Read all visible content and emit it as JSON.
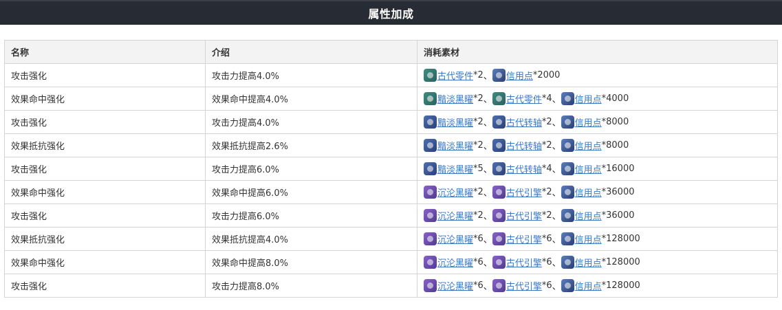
{
  "header": {
    "title": "属性加成"
  },
  "table": {
    "columns": [
      "名称",
      "介绍",
      "消耗素材"
    ],
    "rows": [
      {
        "name": "攻击强化",
        "desc": "攻击力提高4.0%",
        "materials": [
          {
            "icon": "gear-part-icon",
            "color": "green",
            "name": "古代零件",
            "count": "*2",
            "sep": "、"
          },
          {
            "icon": "credit-icon",
            "color": "credit",
            "name": "信用点",
            "count": "*2000",
            "sep": ""
          }
        ]
      },
      {
        "name": "效果命中强化",
        "desc": "效果命中提高4.0%",
        "materials": [
          {
            "icon": "obsidian-icon",
            "color": "green",
            "name": "黯淡黑曜",
            "count": "*2",
            "sep": "、"
          },
          {
            "icon": "gear-part-icon",
            "color": "green",
            "name": "古代零件",
            "count": "*4",
            "sep": "、"
          },
          {
            "icon": "credit-icon",
            "color": "credit",
            "name": "信用点",
            "count": "*4000",
            "sep": ""
          }
        ]
      },
      {
        "name": "攻击强化",
        "desc": "攻击力提高4.0%",
        "materials": [
          {
            "icon": "obsidian-icon",
            "color": "blue",
            "name": "黯淡黑曜",
            "count": "*2",
            "sep": "、"
          },
          {
            "icon": "shaft-icon",
            "color": "blue",
            "name": "古代转轴",
            "count": "*2",
            "sep": "、"
          },
          {
            "icon": "credit-icon",
            "color": "credit",
            "name": "信用点",
            "count": "*8000",
            "sep": ""
          }
        ]
      },
      {
        "name": "效果抵抗强化",
        "desc": "效果抵抗提高2.6%",
        "materials": [
          {
            "icon": "obsidian-icon",
            "color": "blue",
            "name": "黯淡黑曜",
            "count": "*2",
            "sep": "、"
          },
          {
            "icon": "shaft-icon",
            "color": "blue",
            "name": "古代转轴",
            "count": "*2",
            "sep": "、"
          },
          {
            "icon": "credit-icon",
            "color": "credit",
            "name": "信用点",
            "count": "*8000",
            "sep": ""
          }
        ]
      },
      {
        "name": "攻击强化",
        "desc": "攻击力提高6.0%",
        "materials": [
          {
            "icon": "obsidian-icon",
            "color": "blue",
            "name": "黯淡黑曜",
            "count": "*5",
            "sep": "、"
          },
          {
            "icon": "shaft-icon",
            "color": "blue",
            "name": "古代转轴",
            "count": "*4",
            "sep": "、"
          },
          {
            "icon": "credit-icon",
            "color": "credit",
            "name": "信用点",
            "count": "*16000",
            "sep": ""
          }
        ]
      },
      {
        "name": "效果命中强化",
        "desc": "效果命中提高6.0%",
        "materials": [
          {
            "icon": "sinking-obsidian-icon",
            "color": "purple",
            "name": "沉沦黑曜",
            "count": "*2",
            "sep": "、"
          },
          {
            "icon": "engine-icon",
            "color": "purple",
            "name": "古代引擎",
            "count": "*2",
            "sep": "、"
          },
          {
            "icon": "credit-icon",
            "color": "credit",
            "name": "信用点",
            "count": "*36000",
            "sep": ""
          }
        ]
      },
      {
        "name": "攻击强化",
        "desc": "攻击力提高6.0%",
        "materials": [
          {
            "icon": "sinking-obsidian-icon",
            "color": "purple",
            "name": "沉沦黑曜",
            "count": "*2",
            "sep": "、"
          },
          {
            "icon": "engine-icon",
            "color": "purple",
            "name": "古代引擎",
            "count": "*2",
            "sep": "、"
          },
          {
            "icon": "credit-icon",
            "color": "credit",
            "name": "信用点",
            "count": "*36000",
            "sep": ""
          }
        ]
      },
      {
        "name": "效果抵抗强化",
        "desc": "效果抵抗提高4.0%",
        "materials": [
          {
            "icon": "sinking-obsidian-icon",
            "color": "purple",
            "name": "沉沦黑曜",
            "count": "*6",
            "sep": "、"
          },
          {
            "icon": "engine-icon",
            "color": "purple",
            "name": "古代引擎",
            "count": "*6",
            "sep": "、"
          },
          {
            "icon": "credit-icon",
            "color": "credit",
            "name": "信用点",
            "count": "*128000",
            "sep": ""
          }
        ]
      },
      {
        "name": "效果命中强化",
        "desc": "效果命中提高8.0%",
        "materials": [
          {
            "icon": "sinking-obsidian-icon",
            "color": "purple",
            "name": "沉沦黑曜",
            "count": "*6",
            "sep": "、"
          },
          {
            "icon": "engine-icon",
            "color": "purple",
            "name": "古代引擎",
            "count": "*6",
            "sep": "、"
          },
          {
            "icon": "credit-icon",
            "color": "credit",
            "name": "信用点",
            "count": "*128000",
            "sep": ""
          }
        ]
      },
      {
        "name": "攻击强化",
        "desc": "攻击力提高8.0%",
        "materials": [
          {
            "icon": "sinking-obsidian-icon",
            "color": "purple",
            "name": "沉沦黑曜",
            "count": "*6",
            "sep": "、"
          },
          {
            "icon": "engine-icon",
            "color": "purple",
            "name": "古代引擎",
            "count": "*6",
            "sep": "、"
          },
          {
            "icon": "credit-icon",
            "color": "credit",
            "name": "信用点",
            "count": "*128000",
            "sep": ""
          }
        ]
      }
    ]
  },
  "colors": {
    "header_bg": "#272b33",
    "link": "#3a78c4",
    "border": "#d4d4d4",
    "th_bg": "#f3f3f3"
  }
}
